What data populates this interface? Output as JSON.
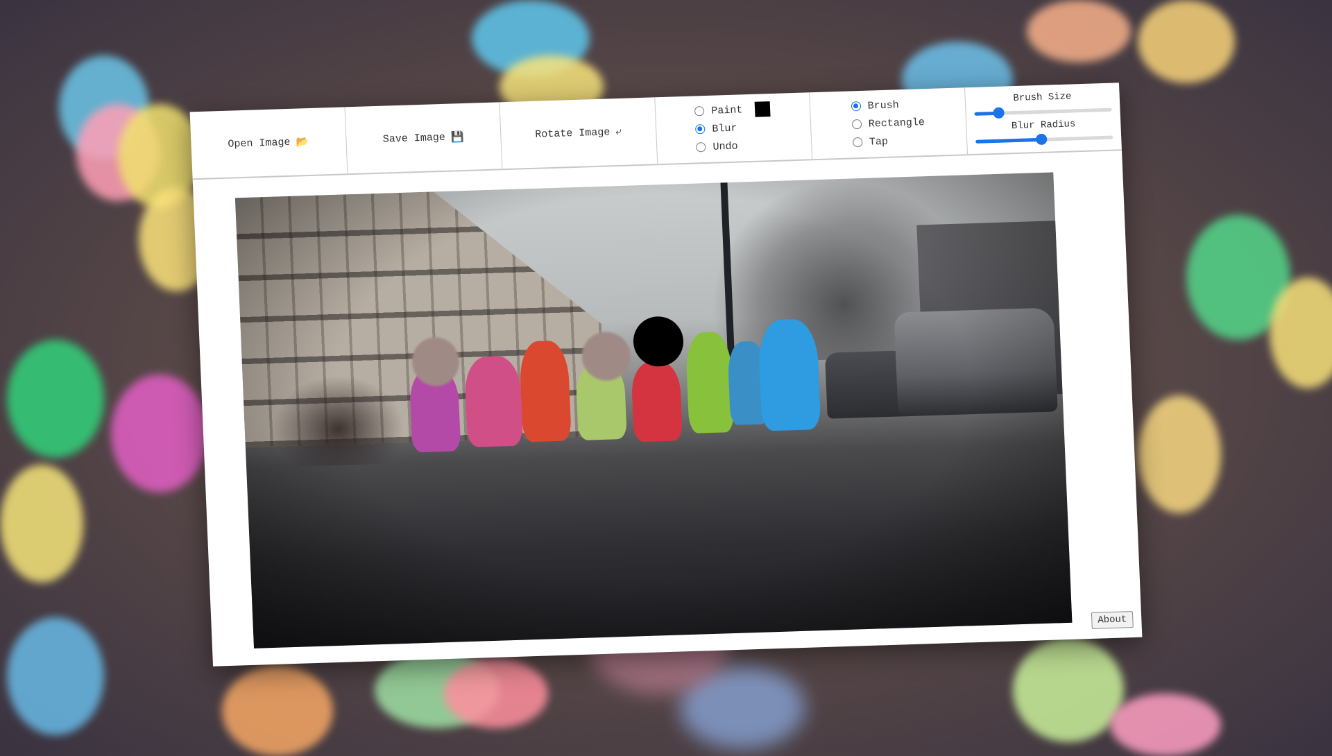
{
  "toolbar": {
    "open_image": "Open Image",
    "open_icon": "folder-icon",
    "save_image": "Save Image",
    "save_icon": "floppy-disk-icon",
    "rotate_image": "Rotate Image",
    "rotate_icon": "rotate-icon",
    "mode_options": [
      {
        "label": "Paint",
        "selected": false
      },
      {
        "label": "Blur",
        "selected": true
      },
      {
        "label": "Undo",
        "selected": false
      }
    ],
    "paint_color": "#000000",
    "tool_options": [
      {
        "label": "Brush",
        "selected": true
      },
      {
        "label": "Rectangle",
        "selected": false
      },
      {
        "label": "Tap",
        "selected": false
      }
    ],
    "brush_size_label": "Brush Size",
    "brush_size_value": 0.18,
    "blur_radius_label": "Blur Radius",
    "blur_radius_value": 0.48
  },
  "about_label": "About",
  "colors": {
    "accent": "#1a73e8"
  }
}
